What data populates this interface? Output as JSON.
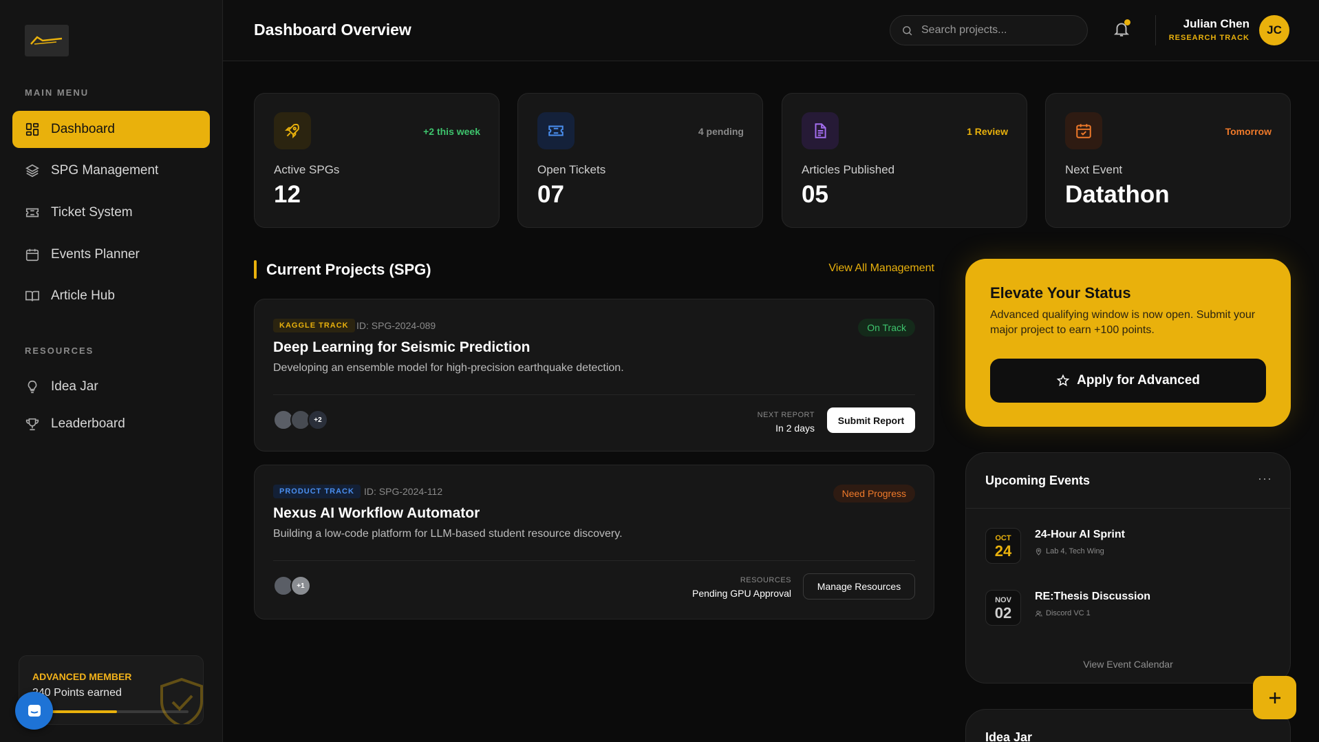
{
  "sidebar": {
    "main_menu_label": "MAIN MENU",
    "resources_label": "RESOURCES",
    "items": [
      {
        "label": "Dashboard",
        "icon": "grid-icon"
      },
      {
        "label": "SPG Management",
        "icon": "layers-icon"
      },
      {
        "label": "Ticket System",
        "icon": "ticket-icon"
      },
      {
        "label": "Events Planner",
        "icon": "calendar-icon"
      },
      {
        "label": "Article Hub",
        "icon": "book-icon"
      }
    ],
    "resources": [
      {
        "label": "Idea Jar",
        "icon": "lightbulb-icon"
      },
      {
        "label": "Leaderboard",
        "icon": "trophy-icon"
      }
    ],
    "member": {
      "title": "ADVANCED MEMBER",
      "points": "240 Points earned",
      "progress": 0.54
    }
  },
  "header": {
    "title": "Dashboard Overview",
    "search_placeholder": "Search projects...",
    "user_name": "Julian Chen",
    "user_track": "RESEARCH TRACK",
    "initials": "JC"
  },
  "stats": [
    {
      "label": "Active SPGs",
      "value": "12",
      "badge": "+2 this week",
      "badge_color": "#3ec46d",
      "icon": "rocket-icon"
    },
    {
      "label": "Open Tickets",
      "value": "07",
      "badge": "4 pending",
      "badge_color": "#8a8a8a",
      "icon": "ticket-icon"
    },
    {
      "label": "Articles Published",
      "value": "05",
      "badge": "1 Review",
      "badge_color": "#e9b10c",
      "icon": "document-icon"
    },
    {
      "label": "Next Event",
      "value": "Datathon",
      "badge": "Tomorrow",
      "badge_color": "#f07a2a",
      "icon": "calendar-check-icon"
    }
  ],
  "projects_section": {
    "title": "Current Projects (SPG)",
    "view_all": "View All Management"
  },
  "projects": [
    {
      "tag": "KAGGLE TRACK",
      "id": "ID: SPG-2024-089",
      "status": "On Track",
      "title": "Deep Learning for Seismic Prediction",
      "desc": "Developing an ensemble model for high-precision earthquake detection.",
      "extra_members": "+2",
      "meta_label": "NEXT REPORT",
      "meta_value": "In 2 days",
      "action": "Submit Report"
    },
    {
      "tag": "PRODUCT TRACK",
      "id": "ID: SPG-2024-112",
      "status": "Need Progress",
      "title": "Nexus AI Workflow Automator",
      "desc": "Building a low-code platform for LLM-based student resource discovery.",
      "extra_members": "+1",
      "meta_label": "RESOURCES",
      "meta_value": "Pending GPU Approval",
      "action": "Manage Resources"
    }
  ],
  "elevate": {
    "title": "Elevate Your Status",
    "desc": "Advanced qualifying window is now open. Submit your major project to earn +100 points.",
    "button": "Apply for Advanced"
  },
  "events": {
    "title": "Upcoming Events",
    "more": "···",
    "items": [
      {
        "month": "OCT",
        "day": "24",
        "name": "24-Hour AI Sprint",
        "location": "Lab 4, Tech Wing",
        "accent": "#e9b10c"
      },
      {
        "month": "NOV",
        "day": "02",
        "name": "RE:Thesis Discussion",
        "location": "Discord VC 1",
        "accent": "#d0d0d0"
      }
    ],
    "calendar_link": "View Event Calendar"
  },
  "idea_jar": {
    "title": "Idea Jar"
  },
  "colors": {
    "accent": "#e9b10c",
    "bg": "#0b0b0b",
    "card": "#171717"
  }
}
